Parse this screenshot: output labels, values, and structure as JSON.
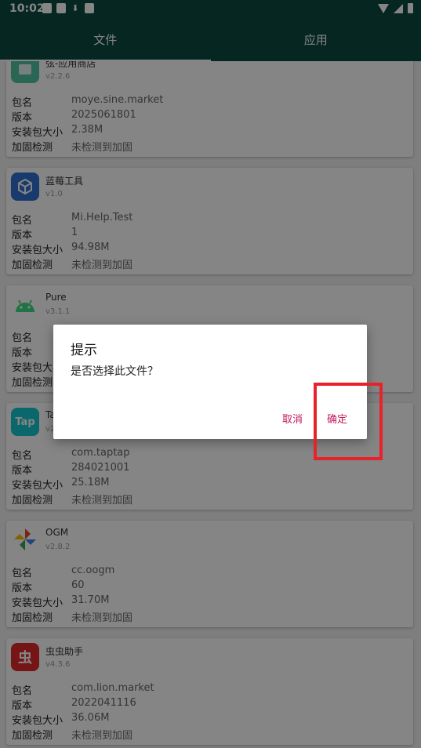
{
  "status_bar": {
    "time": "10:02",
    "download_icon": "download-icon"
  },
  "tabs": [
    {
      "label": "文件",
      "active": true
    },
    {
      "label": "应用",
      "active": false
    }
  ],
  "field_labels": {
    "package": "包名",
    "version": "版本",
    "size": "安装包大小",
    "hardening": "加固检测"
  },
  "apps": [
    {
      "name": "弦-应用商店",
      "version": "v2.2.6",
      "package": "moye.sine.market",
      "version_code": "2025061801",
      "size": "2.38M",
      "hardening": "未检测到加固",
      "icon_color": "#4fc3a1",
      "icon": "store-icon"
    },
    {
      "name": "蓝莓工具",
      "version": "v1.0",
      "package": "Mi.Help.Test",
      "version_code": "1",
      "size": "94.98M",
      "hardening": "未检测到加固",
      "icon_color": "#2f6fd0",
      "icon": "cube-icon"
    },
    {
      "name": "Pure",
      "version": "v3.1.1",
      "package": "",
      "version_code": "",
      "size": "",
      "hardening": "",
      "icon_color": "#3ddc84",
      "icon": "android-icon"
    },
    {
      "name": "Ta",
      "version": "v2",
      "package": "com.taptap",
      "version_code": "284021001",
      "size": "25.18M",
      "hardening": "未检测到加固",
      "icon_color": "#15c5ce",
      "icon": "taptap-icon",
      "icon_text": "Tap"
    },
    {
      "name": "OGM",
      "version": "v2.8.2",
      "package": "cc.oogm",
      "version_code": "60",
      "size": "31.70M",
      "hardening": "未检测到加固",
      "icon_color": "#ffffff",
      "icon": "pinwheel-icon"
    },
    {
      "name": "虫虫助手",
      "version": "v4.3.6",
      "package": "com.lion.market",
      "version_code": "2022041116",
      "size": "36.06M",
      "hardening": "未检测到加固",
      "icon_color": "#e02a2a",
      "icon": "bug-icon",
      "icon_text": "虫"
    }
  ],
  "dialog": {
    "title": "提示",
    "message": "是否选择此文件？",
    "cancel": "取消",
    "confirm": "确定"
  },
  "colors": {
    "toolbar": "#0a4a40",
    "accent": "#c2185b",
    "highlight": "#e8222a"
  }
}
